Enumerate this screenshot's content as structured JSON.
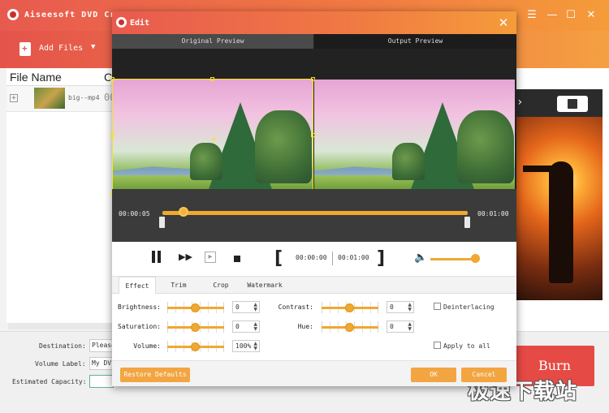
{
  "app": {
    "title": "Aiseesoft DVD Cre",
    "window_controls": [
      "☰",
      "—",
      "☐",
      "✕"
    ],
    "add_files_label": "Add Files",
    "add_files_arrow": "▼",
    "file_list": {
      "header": "File Name",
      "header_next": "C",
      "rows": [
        {
          "name": "big--mp4",
          "extra": "00"
        }
      ]
    },
    "destination_label": "Destination:",
    "destination_value": "Please",
    "volume_label": "Volume Label:",
    "volume_value": "My DV",
    "capacity_label": "Estimated Capacity:",
    "burn_label": "Burn",
    "watermark_text": "极速下载站"
  },
  "edit_dialog": {
    "title": "Edit",
    "close_glyph": "✕",
    "preview": {
      "original_label": "Original Preview",
      "output_label": "Output Preview"
    },
    "timeline": {
      "time_start": "00:00:05",
      "time_end": "00:01:00",
      "playhead_progress": 0.07
    },
    "controls": {
      "clip_start": "00:00:00",
      "clip_end": "00:01:00",
      "volume_level": 0.95
    },
    "tabs": [
      "Effect",
      "Trim",
      "Crop",
      "Watermark"
    ],
    "active_tab": "Effect",
    "effect": {
      "brightness_label": "Brightness:",
      "brightness_value": "0",
      "saturation_label": "Saturation:",
      "saturation_value": "0",
      "volume_label": "Volume:",
      "volume_value": "100%",
      "contrast_label": "Contrast:",
      "contrast_value": "0",
      "hue_label": "Hue:",
      "hue_value": "0",
      "deinterlacing_label": "Deinterlacing",
      "deinterlacing_checked": false,
      "apply_all_label": "Apply to all",
      "apply_all_checked": false
    },
    "footer": {
      "restore_label": "Restore Defaults",
      "ok_label": "OK",
      "cancel_label": "Cancel"
    }
  },
  "colors": {
    "accent": "#f0a830",
    "title_gradient_start": "#e85a4f",
    "title_gradient_end": "#f59c3a",
    "burn": "#e64a45",
    "crop_frame": "#f5e22a"
  }
}
